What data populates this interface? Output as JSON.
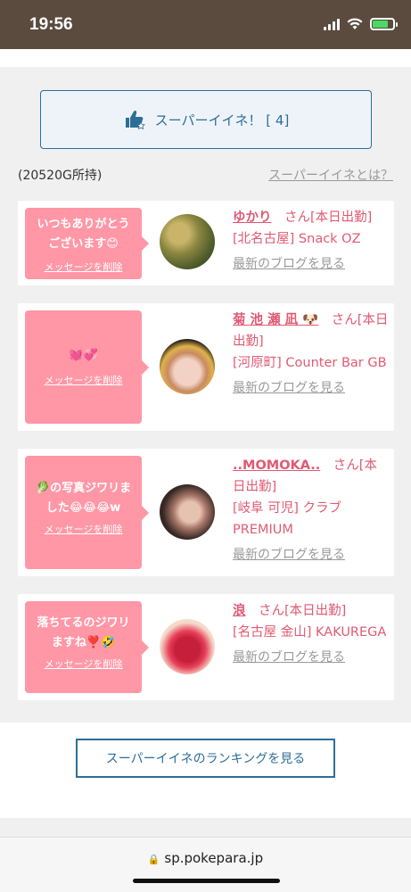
{
  "status": {
    "time": "19:56",
    "battery_level": 0.75
  },
  "super_like": {
    "label": "スーパーイイネ！ [ 4]",
    "icon": "thumbs-up-star-icon"
  },
  "points_text": "(20520G所持)",
  "about_link": "スーパーイイネとは？",
  "delete_label": "メッセージを削除",
  "blog_label": "最新のブログを見る",
  "cards": [
    {
      "message": [
        "いつもありがとう",
        "ございます😊"
      ],
      "name": "ゆかり",
      "suffix": "　さん[本日出勤]",
      "shop": "[北名古屋] Snack OZ"
    },
    {
      "message": [
        "💓💞"
      ],
      "name": "菊 池 瀬 凪 🐶",
      "suffix": "　さん[本日出勤]",
      "shop": "[河原町] Counter Bar GB"
    },
    {
      "message": [
        "🥬の写真ジワリま",
        "した😂😂😂w"
      ],
      "name": "..MOMOKA..",
      "suffix": "　さん[本日出勤]",
      "shop": "[岐阜 可児] クラブPREMIUM"
    },
    {
      "message": [
        "落ちてるのジワリ",
        "ますね❣️🤣"
      ],
      "name": "浪",
      "suffix": "　さん[本日出勤]",
      "shop": "[名古屋 金山] KAKUREGA"
    }
  ],
  "ranking_button": "スーパーイイネのランキングを見る",
  "url": "sp.pokepara.jp",
  "colors": {
    "accent_blue": "#2d6e97",
    "pink": "#ff97a6",
    "name_pink": "#e05a73"
  }
}
